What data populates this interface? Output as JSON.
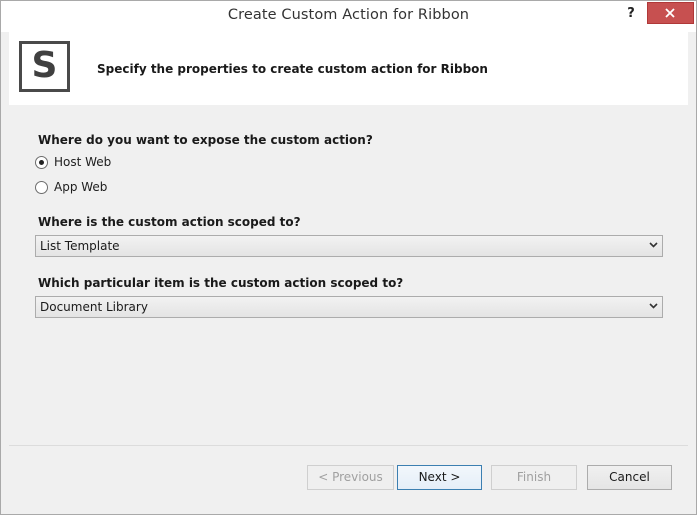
{
  "window": {
    "title": "Create Custom Action for Ribbon",
    "help_label": "?"
  },
  "banner": {
    "logo_letter": "S",
    "text": "Specify the properties to create custom action for Ribbon"
  },
  "form": {
    "expose_question": "Where do you want to expose the custom action?",
    "expose_options": [
      {
        "label": "Host Web",
        "selected": true
      },
      {
        "label": "App Web",
        "selected": false
      }
    ],
    "scope_question": "Where is the custom action scoped to?",
    "scope_value": "List Template",
    "item_question": "Which particular item is the custom action scoped to?",
    "item_value": "Document Library"
  },
  "buttons": {
    "previous": "< Previous",
    "next": "Next >",
    "finish": "Finish",
    "cancel": "Cancel"
  },
  "colors": {
    "close_button": "#c75050",
    "primary_border": "#3c7fb1",
    "disabled_text": "#a0a0a0"
  }
}
